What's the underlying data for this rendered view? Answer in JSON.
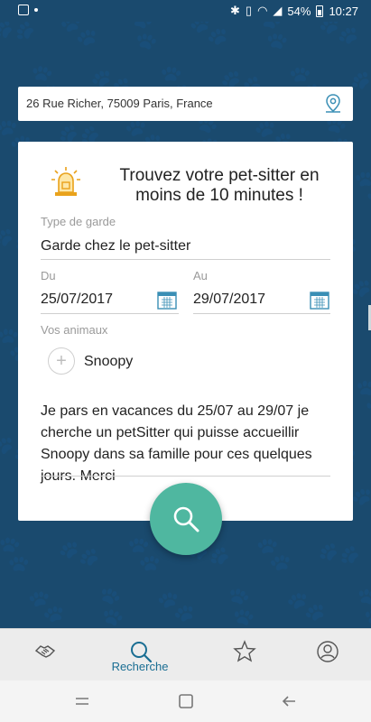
{
  "status_bar": {
    "battery": "54%",
    "time": "10:27"
  },
  "address": {
    "value": "26 Rue Richer, 75009 Paris, France",
    "icon": "location-pin-icon"
  },
  "card": {
    "headline": "Trouvez votre pet-sitter en moins de 10 minutes !",
    "type_label": "Type de garde",
    "type_value": "Garde chez le pet-sitter",
    "from_label": "Du",
    "from_value": "25/07/2017",
    "to_label": "Au",
    "to_value": "29/07/2017",
    "animals_label": "Vos animaux",
    "animal_name": "Snoopy",
    "add_symbol": "+",
    "message": "Je pars en vacances du 25/07 au 29/07 je cherche un petSitter qui puisse accueillir Snoopy dans sa famille pour ces quelques jours. Merci"
  },
  "bottom_nav": {
    "items": [
      {
        "icon": "handshake-icon",
        "label": ""
      },
      {
        "icon": "search-icon",
        "label": "Recherche"
      },
      {
        "icon": "star-icon",
        "label": ""
      },
      {
        "icon": "profile-icon",
        "label": ""
      }
    ]
  },
  "colors": {
    "background": "#1a4a6e",
    "accent": "#4fb7a0",
    "nav_active": "#1a6e93"
  }
}
